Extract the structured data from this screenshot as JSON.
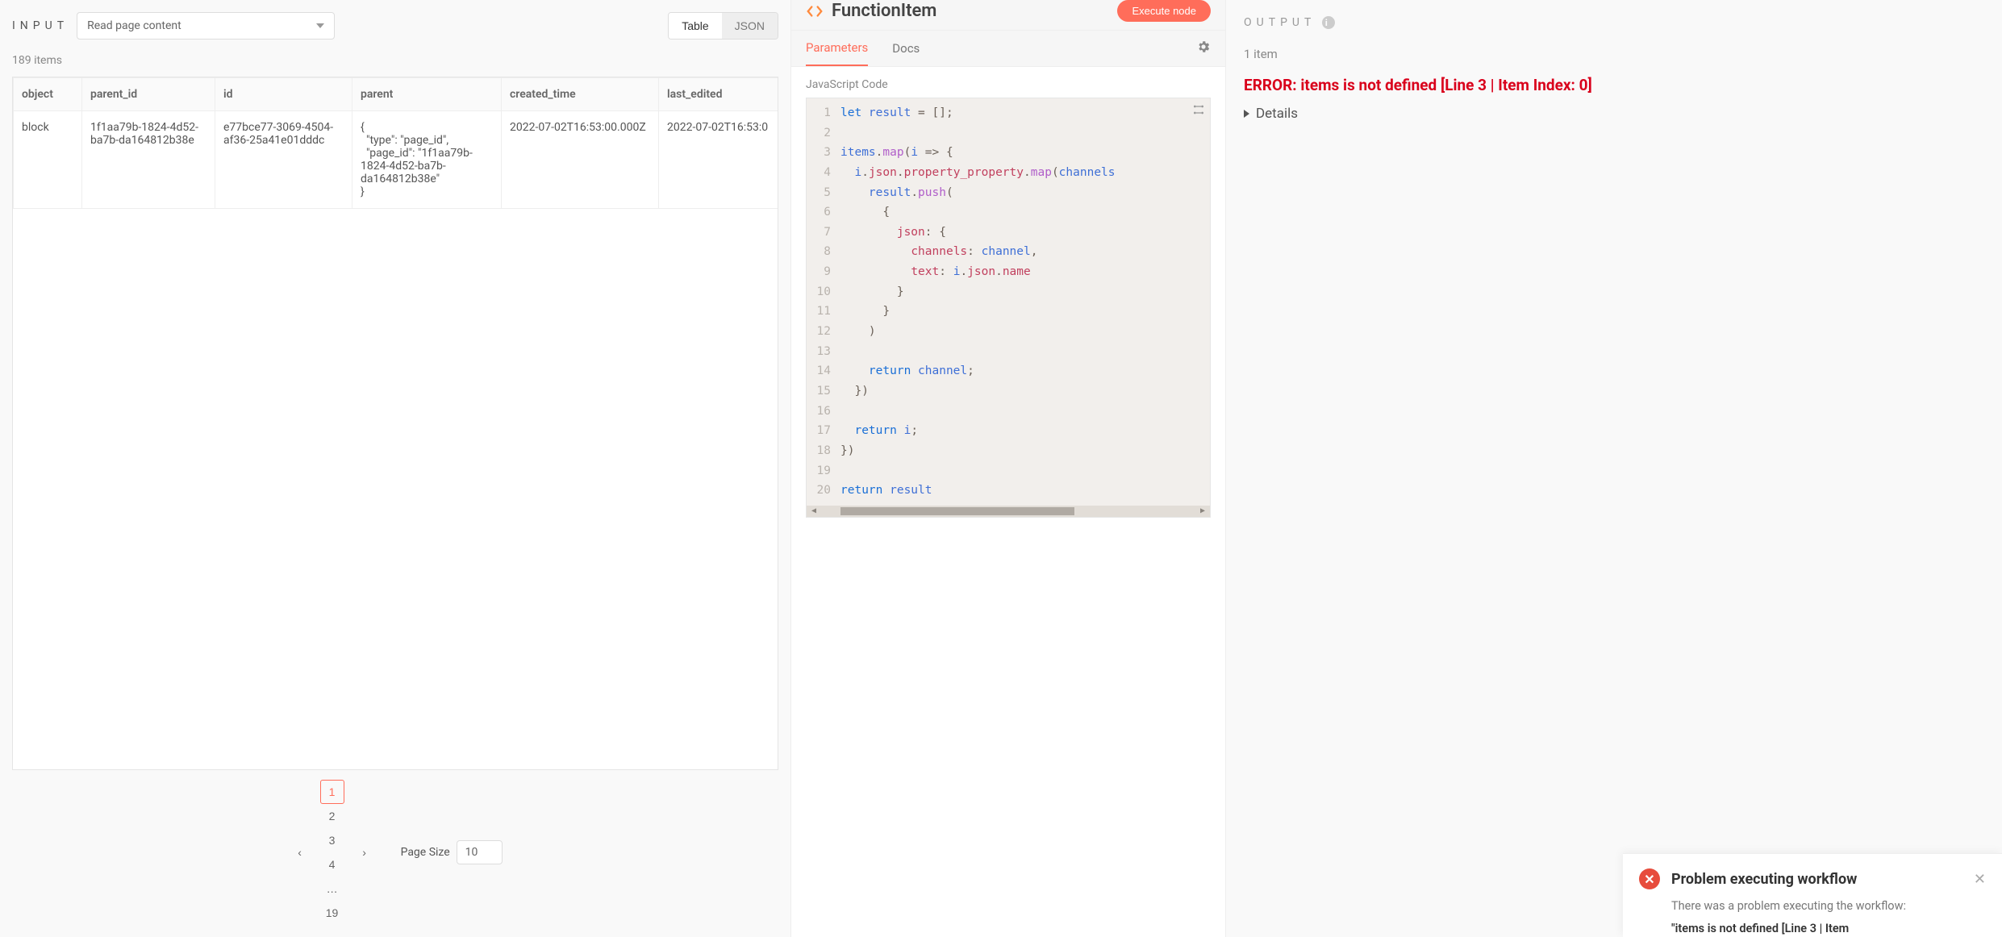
{
  "input": {
    "title": "INPUT",
    "source": "Read page content",
    "view_table": "Table",
    "view_json": "JSON",
    "count": "189 items",
    "columns": [
      "object",
      "parent_id",
      "id",
      "parent",
      "created_time",
      "last_edited"
    ],
    "row": {
      "object": "block",
      "parent_id": "1f1aa79b-1824-4d52-ba7b-da164812b38e",
      "id": "e77bce77-3069-4504-af36-25a41e01dddc",
      "parent": "{\n  \"type\": \"page_id\",\n  \"page_id\": \"1f1aa79b-1824-4d52-ba7b-da164812b38e\"\n}",
      "created_time": "2022-07-02T16:53:00.000Z",
      "last_edited": "2022-07-02T16:53:0"
    },
    "pages": [
      "1",
      "2",
      "3",
      "4",
      "…",
      "19"
    ],
    "page_size_label": "Page Size",
    "page_size_value": "10"
  },
  "center": {
    "node_name": "FunctionItem",
    "execute": "Execute node",
    "tab_params": "Parameters",
    "tab_docs": "Docs",
    "code_label": "JavaScript Code",
    "code": [
      {
        "n": 1,
        "t": [
          [
            "kw",
            "let "
          ],
          [
            "var",
            "result"
          ],
          [
            "op",
            " = []; "
          ]
        ]
      },
      {
        "n": 2,
        "t": []
      },
      {
        "n": 3,
        "t": [
          [
            "var",
            "items"
          ],
          [
            "op",
            "."
          ],
          [
            "fn",
            "map"
          ],
          [
            "op",
            "("
          ],
          [
            "var",
            "i"
          ],
          [
            "op",
            " => {"
          ]
        ]
      },
      {
        "n": 4,
        "t": [
          [
            "op",
            "  "
          ],
          [
            "var",
            "i"
          ],
          [
            "op",
            "."
          ],
          [
            "prop",
            "json"
          ],
          [
            "op",
            "."
          ],
          [
            "prop",
            "property_property"
          ],
          [
            "op",
            "."
          ],
          [
            "fn",
            "map"
          ],
          [
            "op",
            "("
          ],
          [
            "var",
            "channels"
          ]
        ]
      },
      {
        "n": 5,
        "t": [
          [
            "op",
            "    "
          ],
          [
            "var",
            "result"
          ],
          [
            "op",
            "."
          ],
          [
            "fn",
            "push"
          ],
          [
            "op",
            "( "
          ]
        ]
      },
      {
        "n": 6,
        "t": [
          [
            "op",
            "      {"
          ]
        ]
      },
      {
        "n": 7,
        "t": [
          [
            "op",
            "        "
          ],
          [
            "prop",
            "json"
          ],
          [
            "op",
            ": {"
          ]
        ]
      },
      {
        "n": 8,
        "t": [
          [
            "op",
            "          "
          ],
          [
            "prop",
            "channels"
          ],
          [
            "op",
            ": "
          ],
          [
            "var",
            "channel"
          ],
          [
            "op",
            ","
          ]
        ]
      },
      {
        "n": 9,
        "t": [
          [
            "op",
            "          "
          ],
          [
            "prop",
            "text"
          ],
          [
            "op",
            ": "
          ],
          [
            "var",
            "i"
          ],
          [
            "op",
            "."
          ],
          [
            "prop",
            "json"
          ],
          [
            "op",
            "."
          ],
          [
            "prop",
            "name"
          ]
        ]
      },
      {
        "n": 10,
        "t": [
          [
            "op",
            "        }"
          ]
        ]
      },
      {
        "n": 11,
        "t": [
          [
            "op",
            "      }"
          ]
        ]
      },
      {
        "n": 12,
        "t": [
          [
            "op",
            "    ) "
          ]
        ]
      },
      {
        "n": 13,
        "t": []
      },
      {
        "n": 14,
        "t": [
          [
            "op",
            "    "
          ],
          [
            "kw",
            "return "
          ],
          [
            "var",
            "channel"
          ],
          [
            "op",
            ";"
          ]
        ]
      },
      {
        "n": 15,
        "t": [
          [
            "op",
            "  })"
          ]
        ]
      },
      {
        "n": 16,
        "t": []
      },
      {
        "n": 17,
        "t": [
          [
            "op",
            "  "
          ],
          [
            "kw",
            "return "
          ],
          [
            "var",
            "i"
          ],
          [
            "op",
            ";"
          ]
        ]
      },
      {
        "n": 18,
        "t": [
          [
            "op",
            "})"
          ]
        ]
      },
      {
        "n": 19,
        "t": []
      },
      {
        "n": 20,
        "t": [
          [
            "kw",
            "return "
          ],
          [
            "var",
            "result"
          ]
        ]
      }
    ]
  },
  "output": {
    "title": "OUTPUT",
    "count": "1 item",
    "error": "ERROR: items is not defined [Line 3 | Item Index: 0]",
    "details": "Details"
  },
  "toast": {
    "title": "Problem executing workflow",
    "body": "There was a problem executing the workflow:",
    "err": "\"items is not defined [Line 3 | Item"
  }
}
